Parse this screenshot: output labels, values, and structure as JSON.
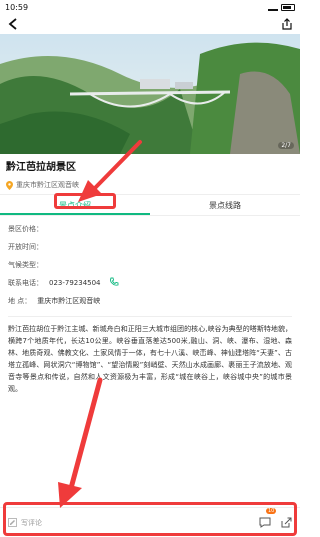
{
  "status_bar": {
    "time": "10:59"
  },
  "nav": {
    "back_icon": "back-arrow-icon",
    "share_icon": "share-icon"
  },
  "hero": {
    "page_indicator": "2/7"
  },
  "place": {
    "title": "黔江芭拉胡景区",
    "address": "重庆市黔江区观音峡"
  },
  "tabs": [
    {
      "label": "景点介绍",
      "active": true
    },
    {
      "label": "景点线路",
      "active": false
    }
  ],
  "info": {
    "price_label": "景区价格：",
    "hours_label": "开放时间：",
    "weather_label": "气候类型：",
    "phone_label": "联系电话：",
    "phone_value": "023-79234504",
    "address_label": "地    点：",
    "address_value": "重庆市黔江区观音峡"
  },
  "description": "黔江芭拉胡位于黔江主城、新城舟白和正阳三大城市组团的核心,峡谷为典型的嗒斯特地貌，横跨7个地质年代，长达10公里。峡谷垂直落差达500米,融山、洞、峡、瀑布、湿地、森林、地质奇观、佛教文化、土家风情于一体，有七十八溪、峡峦峰、神仙建塔阵“天妻”、古塔立孤峰、网状洞穴“博物馆”、“望治情殿”刻峭壁、天然山水成画廊、裹丽王子流放地、观音寺等景点和传说，自然和人文资源极为丰富，形成“城在峡谷上，峡谷城中央”的城市景观。",
  "bottom_bar": {
    "comment_placeholder": "写评论",
    "badge_count": "10"
  },
  "colors": {
    "accent": "#10b981",
    "annotation": "#ef3b3b",
    "badge": "#f97316"
  }
}
